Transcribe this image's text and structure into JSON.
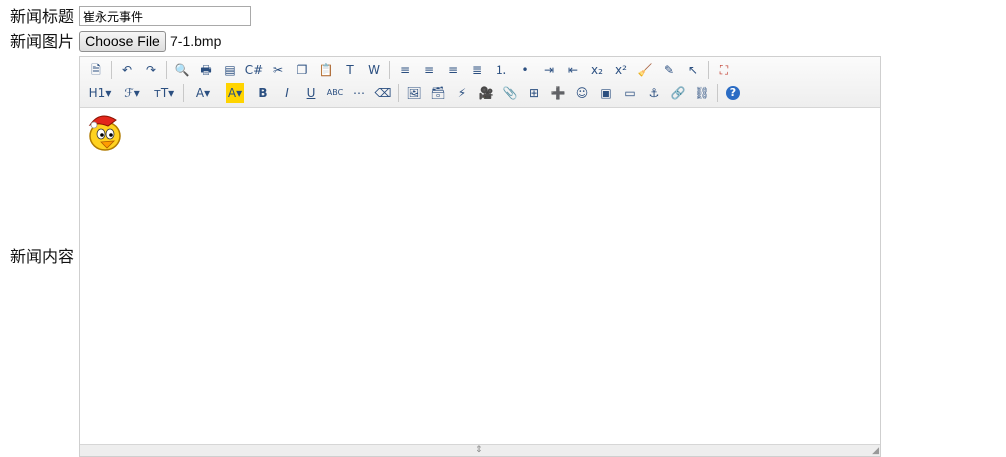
{
  "form": {
    "title_label": "新闻标题",
    "title_value": "崔永元事件",
    "image_label": "新闻图片",
    "choose_file_label": "Choose File",
    "file_name": "7-1.bmp",
    "content_label": "新闻内容"
  },
  "editor": {
    "toolbar_row1": [
      {
        "name": "source-icon",
        "glyph": "🗎"
      },
      {
        "sep": true
      },
      {
        "name": "undo-icon",
        "glyph": "↶"
      },
      {
        "name": "redo-icon",
        "glyph": "↷"
      },
      {
        "sep": true
      },
      {
        "name": "preview-icon",
        "glyph": "🔍"
      },
      {
        "name": "print-icon",
        "glyph": "🖶"
      },
      {
        "name": "template-icon",
        "glyph": "▤"
      },
      {
        "name": "code-icon",
        "glyph": "C#"
      },
      {
        "name": "cut-icon",
        "glyph": "✂"
      },
      {
        "name": "copy-icon",
        "glyph": "❐"
      },
      {
        "name": "paste-icon",
        "glyph": "📋"
      },
      {
        "name": "paste-text-icon",
        "glyph": "T"
      },
      {
        "name": "paste-word-icon",
        "glyph": "W"
      },
      {
        "sep": true
      },
      {
        "name": "align-left-icon",
        "glyph": "≡"
      },
      {
        "name": "align-center-icon",
        "glyph": "≡"
      },
      {
        "name": "align-right-icon",
        "glyph": "≡"
      },
      {
        "name": "justify-icon",
        "glyph": "≣"
      },
      {
        "name": "ordered-list-icon",
        "glyph": "⒈"
      },
      {
        "name": "unordered-list-icon",
        "glyph": "•"
      },
      {
        "name": "indent-icon",
        "glyph": "⇥"
      },
      {
        "name": "outdent-icon",
        "glyph": "⇤"
      },
      {
        "name": "subscript-icon",
        "glyph": "x₂"
      },
      {
        "name": "superscript-icon",
        "glyph": "x²"
      },
      {
        "name": "clear-format-icon",
        "glyph": "🧹"
      },
      {
        "name": "select-all-icon",
        "glyph": "✎"
      },
      {
        "name": "cursor-icon",
        "glyph": "↖"
      },
      {
        "sep": true
      },
      {
        "name": "fullscreen-icon",
        "glyph": "⛶"
      }
    ],
    "toolbar_row2": [
      {
        "name": "heading-icon",
        "glyph": "H1▾",
        "wide": true
      },
      {
        "name": "font-family-icon",
        "glyph": "ℱ▾",
        "wide": true
      },
      {
        "name": "font-size-icon",
        "glyph": "тT▾",
        "wide": true
      },
      {
        "sep": true
      },
      {
        "name": "font-color-icon",
        "glyph": "A▾",
        "wide": true
      },
      {
        "name": "highlight-color-icon",
        "glyph": "A▾",
        "wide": true,
        "bg": "#ffd400"
      },
      {
        "name": "bold-icon",
        "glyph": "B"
      },
      {
        "name": "italic-icon",
        "glyph": "I"
      },
      {
        "name": "underline-icon",
        "glyph": "U"
      },
      {
        "name": "strikethrough-icon",
        "glyph": "ABC"
      },
      {
        "name": "horizontal-rule-icon",
        "glyph": "⋯"
      },
      {
        "name": "eraser-icon",
        "glyph": "⌫"
      },
      {
        "sep": true
      },
      {
        "name": "insert-image-icon",
        "glyph": "🖼"
      },
      {
        "name": "insert-multi-image-icon",
        "glyph": "🗃"
      },
      {
        "name": "insert-flash-icon",
        "glyph": "⚡"
      },
      {
        "name": "insert-media-icon",
        "glyph": "🎥"
      },
      {
        "name": "attachment-icon",
        "glyph": "📎"
      },
      {
        "name": "table-icon",
        "glyph": "⊞"
      },
      {
        "name": "insert-line-icon",
        "glyph": "➕"
      },
      {
        "name": "emoticon-icon",
        "glyph": "☺"
      },
      {
        "name": "image-manager-icon",
        "glyph": "▣"
      },
      {
        "name": "page-break-icon",
        "glyph": "▭"
      },
      {
        "name": "anchor-icon",
        "glyph": "⚓"
      },
      {
        "name": "link-icon",
        "glyph": "🔗"
      },
      {
        "name": "unlink-icon",
        "glyph": "⛓"
      },
      {
        "sep": true
      },
      {
        "name": "help-icon",
        "glyph": "?"
      }
    ]
  },
  "colors": {
    "toolbar_icon": "#2b4f80",
    "highlight": "#ffd400",
    "border": "#cfcfcf"
  }
}
